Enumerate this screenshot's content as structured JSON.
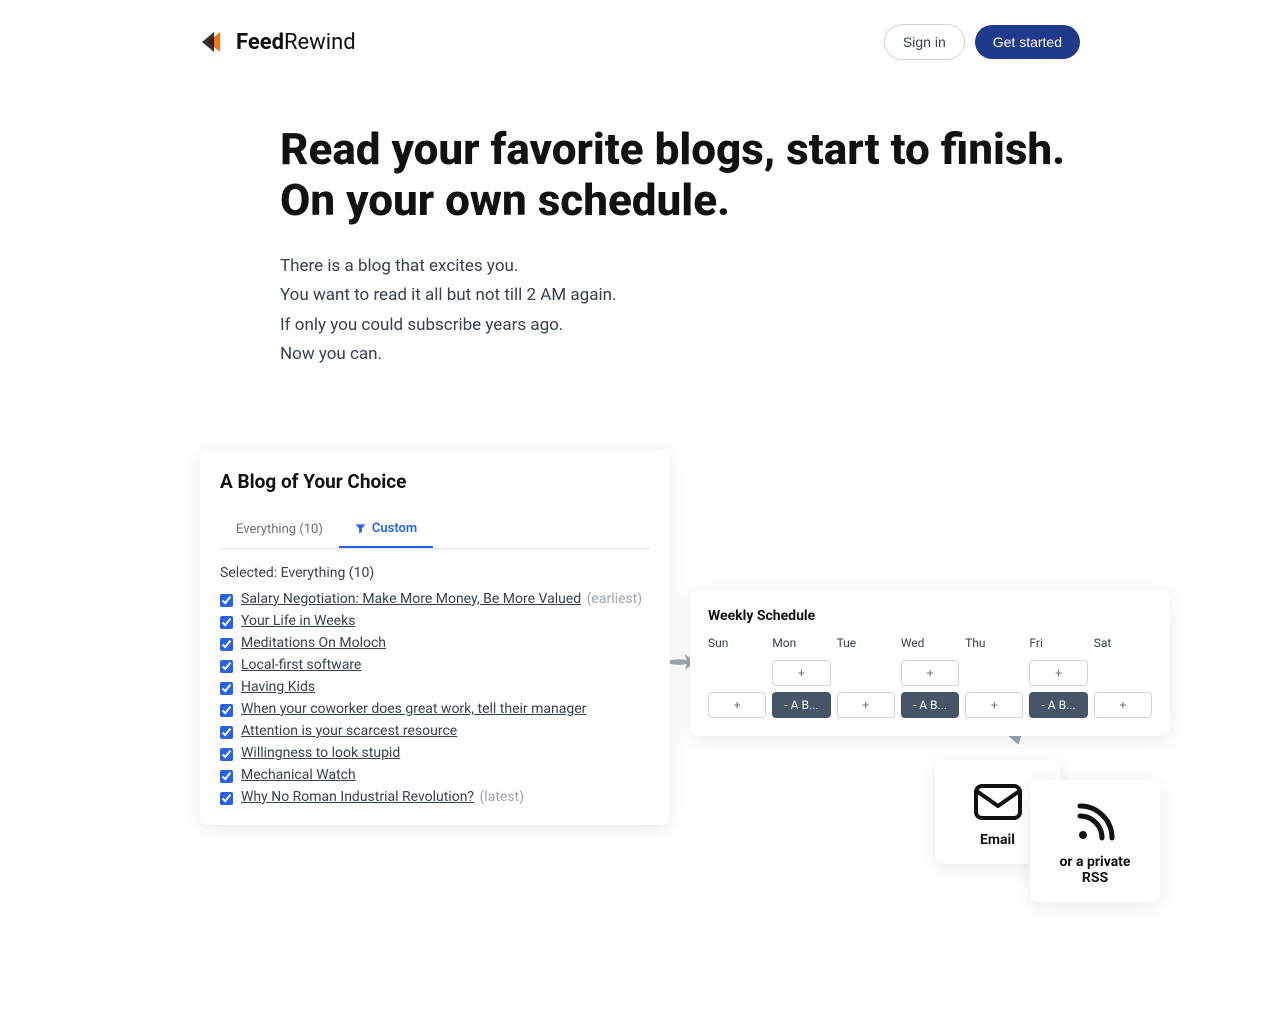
{
  "header": {
    "logo_bold": "Feed",
    "logo_thin": "Rewind",
    "sign_in": "Sign in",
    "get_started": "Get started"
  },
  "hero": {
    "title_line1": "Read your favorite blogs, start to finish.",
    "title_line2": "On your own schedule.",
    "sub1": "There is a blog that excites you.",
    "sub2": "You want to read it all but not till 2 AM again.",
    "sub3": "If only you could subscribe years ago.",
    "sub4": "Now you can."
  },
  "blog": {
    "title": "A Blog of Your Choice",
    "tab_everything": "Everything (10)",
    "tab_custom": "Custom",
    "selected": "Selected: Everything (10)",
    "posts": [
      {
        "label": "Salary Negotiation: Make More Money, Be More Valued",
        "marker": "(earliest)"
      },
      {
        "label": "Your Life in Weeks"
      },
      {
        "label": "Meditations On Moloch"
      },
      {
        "label": "Local-first software"
      },
      {
        "label": "Having Kids"
      },
      {
        "label": "When your coworker does great work, tell their manager"
      },
      {
        "label": "Attention is your scarcest resource"
      },
      {
        "label": "Willingness to look stupid"
      },
      {
        "label": "Mechanical Watch"
      },
      {
        "label": "Why No Roman Industrial Revolution?",
        "marker": "(latest)"
      }
    ]
  },
  "schedule": {
    "title": "Weekly Schedule",
    "days": [
      "Sun",
      "Mon",
      "Tue",
      "Wed",
      "Thu",
      "Fri",
      "Sat"
    ],
    "rows": [
      [
        "",
        "+",
        "",
        "+",
        "",
        "+",
        ""
      ],
      [
        "+",
        "- A B...",
        "+",
        "- A B...",
        "+",
        "- A B...",
        "+"
      ]
    ],
    "filled": [
      [
        false,
        false,
        false,
        false,
        false,
        false,
        false
      ],
      [
        false,
        true,
        false,
        true,
        false,
        true,
        false
      ]
    ]
  },
  "delivery": {
    "email": "Email",
    "rss": "or a private RSS"
  }
}
